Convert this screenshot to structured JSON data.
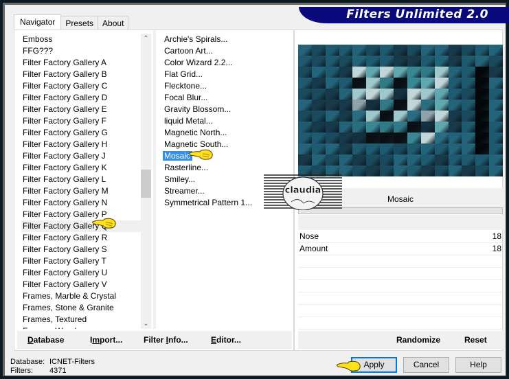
{
  "app": {
    "brand_title": "Filters Unlimited 2.0"
  },
  "tabs": [
    {
      "label": "Navigator",
      "active": true
    },
    {
      "label": "Presets",
      "active": false
    },
    {
      "label": "About",
      "active": false
    }
  ],
  "categories": {
    "items": [
      "Emboss",
      "FFG???",
      "Filter Factory Gallery A",
      "Filter Factory Gallery B",
      "Filter Factory Gallery C",
      "Filter Factory Gallery D",
      "Filter Factory Gallery E",
      "Filter Factory Gallery F",
      "Filter Factory Gallery G",
      "Filter Factory Gallery H",
      "Filter Factory Gallery J",
      "Filter Factory Gallery K",
      "Filter Factory Gallery L",
      "Filter Factory Gallery M",
      "Filter Factory Gallery N",
      "Filter Factory Gallery P",
      "Filter Factory Gallery Q",
      "Filter Factory Gallery R",
      "Filter Factory Gallery S",
      "Filter Factory Gallery T",
      "Filter Factory Gallery U",
      "Filter Factory Gallery V",
      "Frames, Marble & Crystal",
      "Frames, Stone & Granite",
      "Frames, Textured",
      "Frames, Wood"
    ],
    "highlighted": "Filter Factory Gallery Q"
  },
  "filters": {
    "items": [
      "Archie's Spirals...",
      "Cartoon Art...",
      "Color Wizard 2.2...",
      "Flat Grid...",
      "Flecktone...",
      "Focal Blur...",
      "Gravity Blossom...",
      "liquid Metal...",
      "Magnetic North...",
      "Magnetic South...",
      "Mosaic",
      "Rasterline...",
      "Smiley...",
      "Streamer...",
      "Symmetrical Pattern 1..."
    ],
    "selected": "Mosaic"
  },
  "left_buttons": [
    {
      "pre": "",
      "ul": "D",
      "post": "atabase"
    },
    {
      "pre": "I",
      "ul": "m",
      "post": "port..."
    },
    {
      "pre": "Filter ",
      "ul": "I",
      "post": "nfo..."
    },
    {
      "pre": "",
      "ul": "E",
      "post": "ditor..."
    }
  ],
  "filter_panel": {
    "title": "Mosaic",
    "params": [
      {
        "name": "Nose",
        "value": "18"
      },
      {
        "name": "Amount",
        "value": "18"
      }
    ],
    "randomize_label": "Randomize",
    "reset_label": "Reset"
  },
  "watermark": {
    "text": "claudia"
  },
  "status": {
    "database_label": "Database:",
    "database_value": "ICNET-Filters",
    "filters_label": "Filters:",
    "filters_value": "4371"
  },
  "dialog_buttons": {
    "apply": "Apply",
    "cancel": "Cancel",
    "help": "Help"
  },
  "colors": {
    "brand_bg": "#0a0a7c",
    "selection": "#3390e6",
    "default_button_border": "#0078d7"
  }
}
